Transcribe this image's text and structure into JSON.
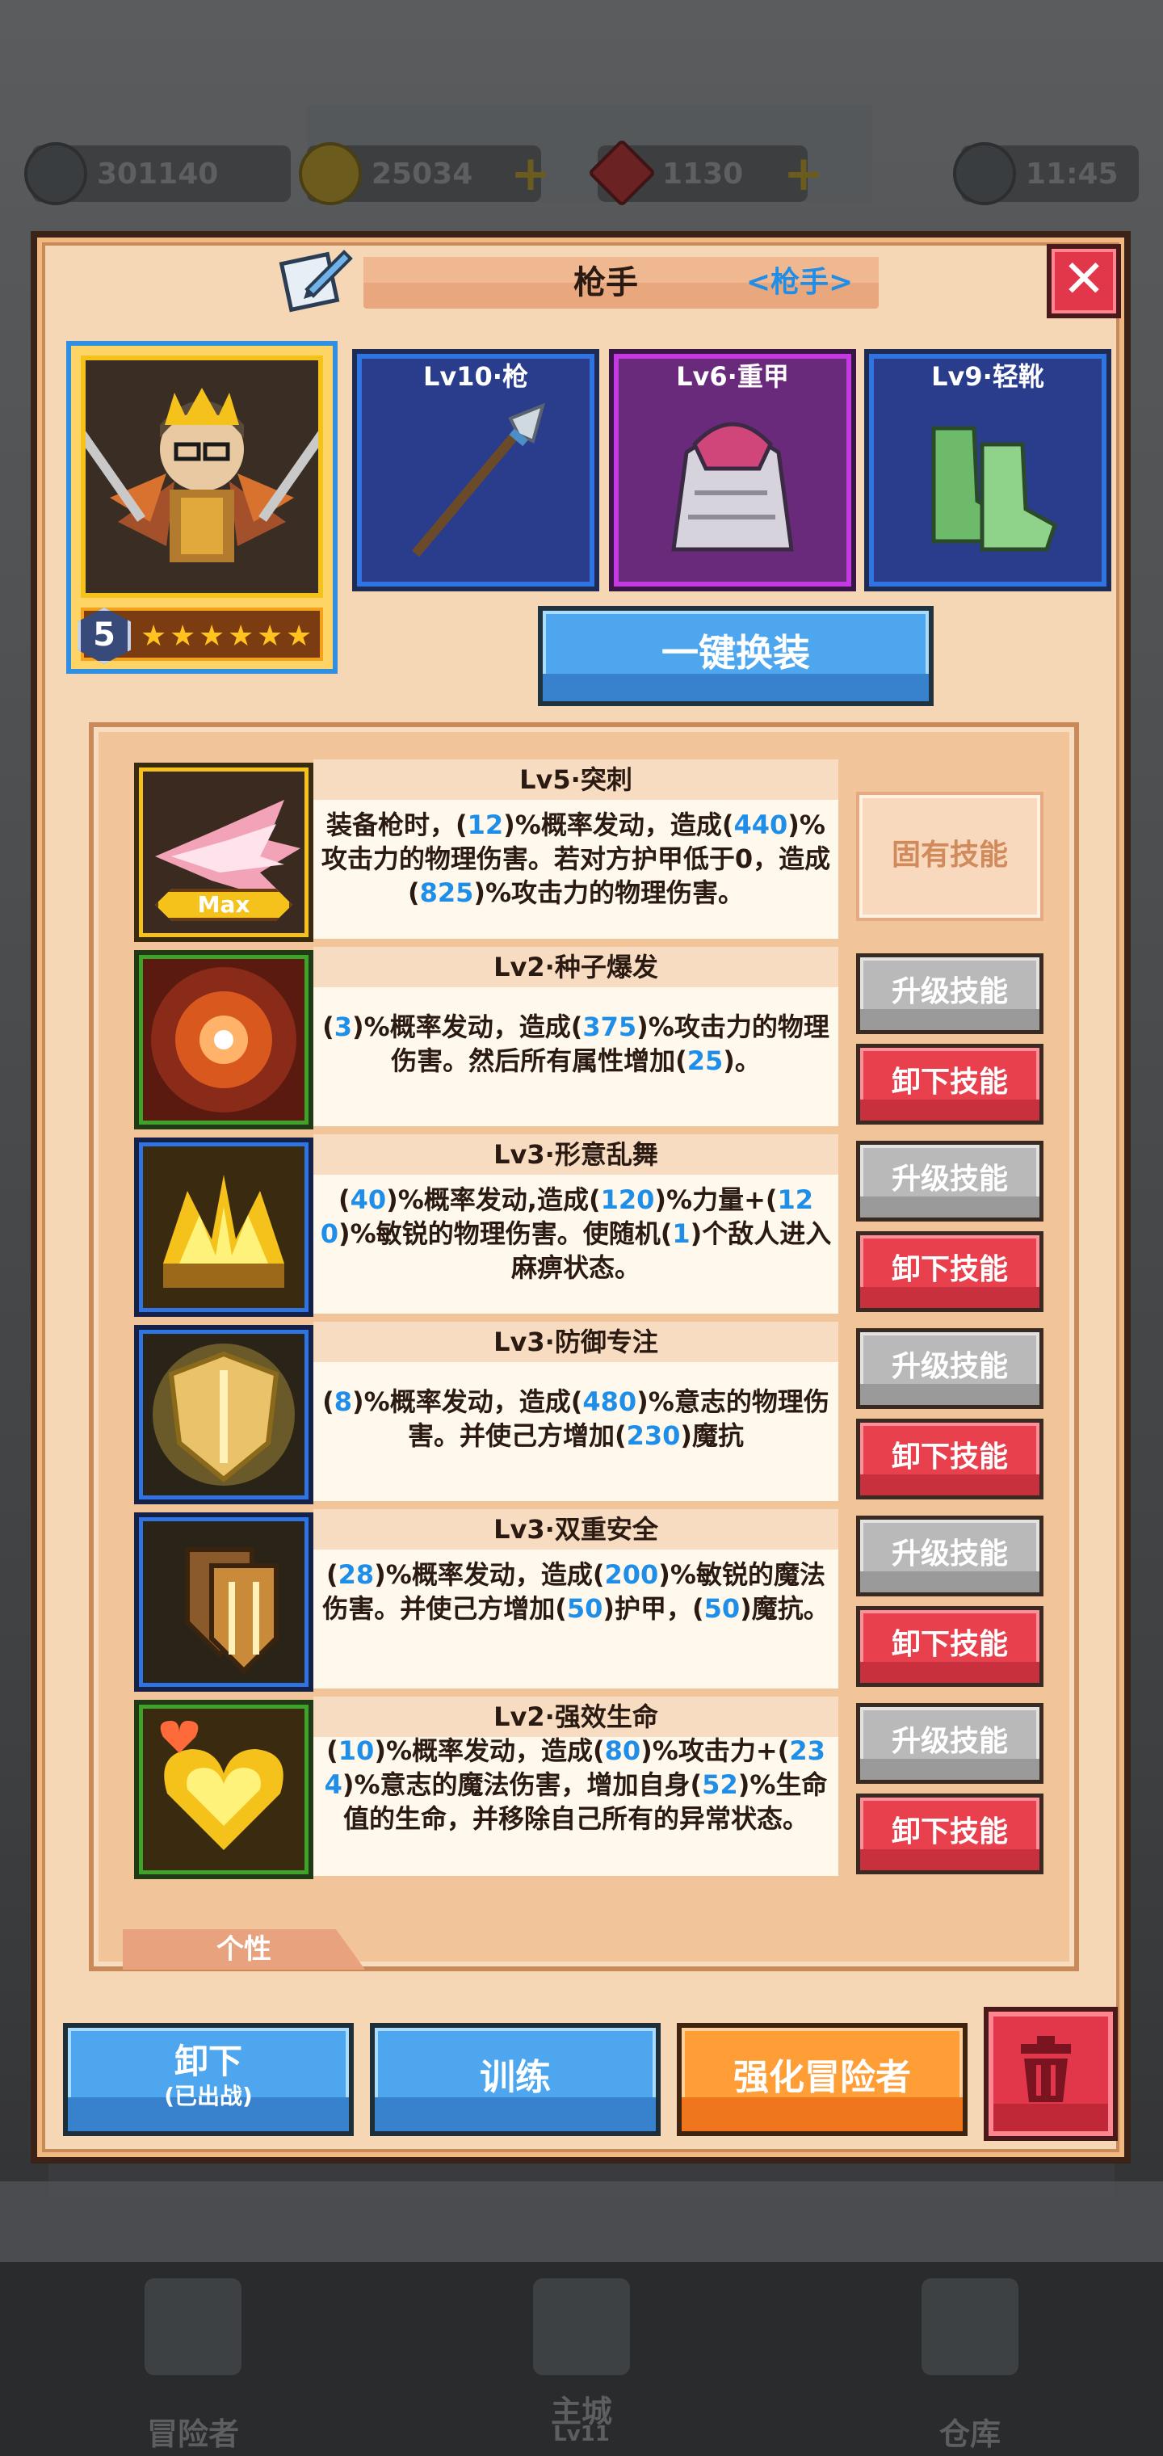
{
  "topbar": {
    "resources": [
      {
        "name": "power",
        "icon": "sword-power-icon",
        "value": "301140"
      },
      {
        "name": "gold",
        "icon": "gold-coin-icon",
        "value": "25034"
      },
      {
        "name": "gem",
        "icon": "red-gem-icon",
        "value": "1130"
      }
    ],
    "time": "11:45"
  },
  "dialog": {
    "title": "枪手",
    "class_label": "<枪手>",
    "close_label": "✕"
  },
  "hero": {
    "level": "5",
    "stars": 6
  },
  "equipment": [
    {
      "label": "Lv10·枪",
      "icon": "spear-icon",
      "color": "#2a3c8c",
      "border": "#2f74e0"
    },
    {
      "label": "Lv6·重甲",
      "icon": "heavy-armor-icon",
      "color": "#6a2a7c",
      "border": "#c23ae0"
    },
    {
      "label": "Lv9·轻靴",
      "icon": "light-boots-icon",
      "color": "#2a3c8c",
      "border": "#2f74e0"
    }
  ],
  "oneclick_label": "一键换装",
  "skills": [
    {
      "title": "Lv5·突刺",
      "icon": "thrust-skill-icon",
      "frame": "#f5c21b",
      "badge": "Max",
      "desc": [
        {
          "t": "装备枪时，("
        },
        {
          "n": "12"
        },
        {
          "t": ")%概率发动，造成("
        },
        {
          "n": "440"
        },
        {
          "t": ")%攻击力的物理伤害。若对方护甲低于0，造成("
        },
        {
          "n": "825"
        },
        {
          "t": ")%攻击力的物理伤害。"
        }
      ],
      "buttons": [
        {
          "label": "固有技能",
          "style": "innate"
        }
      ]
    },
    {
      "title": "Lv2·种子爆发",
      "icon": "seed-burst-icon",
      "frame": "#3fa32a",
      "desc": [
        {
          "t": "("
        },
        {
          "n": "3"
        },
        {
          "t": ")%概率发动，造成("
        },
        {
          "n": "375"
        },
        {
          "t": ")%攻击力的物理伤害。然后所有属性增加("
        },
        {
          "n": "25"
        },
        {
          "t": ")。"
        }
      ],
      "buttons": [
        {
          "label": "升级技能",
          "style": "gray"
        },
        {
          "label": "卸下技能",
          "style": "red"
        }
      ]
    },
    {
      "title": "Lv3·形意乱舞",
      "icon": "frenzy-dance-icon",
      "frame": "#2f74e0",
      "desc": [
        {
          "t": "("
        },
        {
          "n": "40"
        },
        {
          "t": ")%概率发动,造成("
        },
        {
          "n": "120"
        },
        {
          "t": ")%力量+("
        },
        {
          "n": "120"
        },
        {
          "t": ")%敏锐的物理伤害。使随机("
        },
        {
          "n": "1"
        },
        {
          "t": ")个敌人进入麻痹状态。"
        }
      ],
      "buttons": [
        {
          "label": "升级技能",
          "style": "gray"
        },
        {
          "label": "卸下技能",
          "style": "red"
        }
      ]
    },
    {
      "title": "Lv3·防御专注",
      "icon": "shield-focus-icon",
      "frame": "#2f74e0",
      "desc": [
        {
          "t": "("
        },
        {
          "n": "8"
        },
        {
          "t": ")%概率发动，造成("
        },
        {
          "n": "480"
        },
        {
          "t": ")%意志的物理伤害。并使己方增加("
        },
        {
          "n": "230"
        },
        {
          "t": ")魔抗"
        }
      ],
      "buttons": [
        {
          "label": "升级技能",
          "style": "gray"
        },
        {
          "label": "卸下技能",
          "style": "red"
        }
      ]
    },
    {
      "title": "Lv3·双重安全",
      "icon": "double-shield-icon",
      "frame": "#2f74e0",
      "desc": [
        {
          "t": "("
        },
        {
          "n": "28"
        },
        {
          "t": ")%概率发动，造成("
        },
        {
          "n": "200"
        },
        {
          "t": ")%敏锐的魔法伤害。并使己方增加("
        },
        {
          "n": "50"
        },
        {
          "t": ")护甲，("
        },
        {
          "n": "50"
        },
        {
          "t": ")魔抗。"
        }
      ],
      "buttons": [
        {
          "label": "升级技能",
          "style": "gray"
        },
        {
          "label": "卸下技能",
          "style": "red"
        }
      ]
    },
    {
      "title": "Lv2·强效生命",
      "icon": "strong-life-icon",
      "frame": "#3fa32a",
      "desc": [
        {
          "t": "("
        },
        {
          "n": "10"
        },
        {
          "t": ")%概率发动，造成("
        },
        {
          "n": "80"
        },
        {
          "t": ")%攻击力+("
        },
        {
          "n": "234"
        },
        {
          "t": ")%意志的魔法伤害，增加自身("
        },
        {
          "n": "52"
        },
        {
          "t": ")%生命值的生命，并移除自己所有的异常状态。"
        }
      ],
      "buttons": [
        {
          "label": "升级技能",
          "style": "gray"
        },
        {
          "label": "卸下技能",
          "style": "red"
        }
      ]
    }
  ],
  "trait_tab": "个性",
  "bottom_buttons": {
    "unequip": {
      "label": "卸下",
      "sub": "(已出战)"
    },
    "train": {
      "label": "训练"
    },
    "enhance": {
      "label": "强化冒险者"
    },
    "delete_icon": "trash-icon"
  },
  "nav": [
    {
      "label": "冒险者",
      "icon": "adventurer-icon"
    },
    {
      "label": "主城",
      "sub": "Lv11",
      "icon": "castle-icon"
    },
    {
      "label": "仓库",
      "icon": "warehouse-icon"
    }
  ]
}
